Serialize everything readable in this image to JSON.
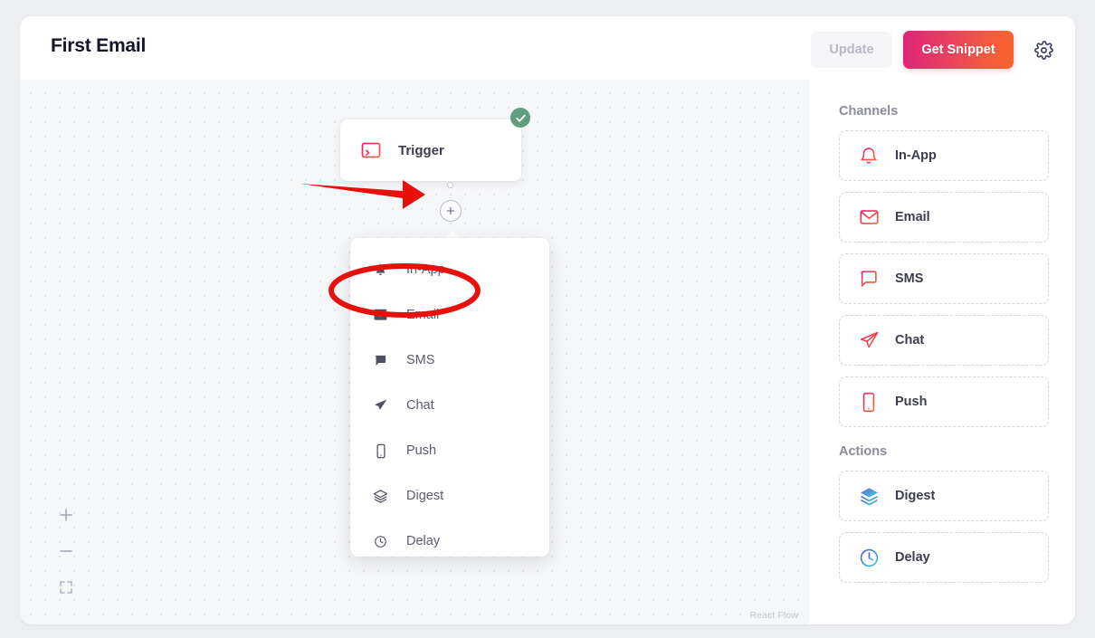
{
  "header": {
    "title": "First Email",
    "update_label": "Update",
    "snippet_label": "Get Snippet",
    "gear_icon": "gear-icon",
    "snippet_gradient_start": "#dd2476",
    "snippet_gradient_end": "#f7642c",
    "update_bg": "#f5f5f8",
    "update_text_color": "#b9b9c6"
  },
  "canvas": {
    "trigger_node": {
      "label": "Trigger",
      "icon": "terminal-icon",
      "status_icon": "check-circle-icon",
      "status_color": "#5f9e81"
    },
    "add_node_button": {
      "icon": "plus-icon"
    },
    "attribution": "React Flow",
    "controls": [
      {
        "name": "zoom-in",
        "icon": "plus-icon"
      },
      {
        "name": "zoom-out",
        "icon": "minus-icon"
      },
      {
        "name": "fit-view",
        "icon": "fit-view-icon"
      }
    ],
    "dropdown": {
      "items": [
        {
          "label": "In-App",
          "icon": "bell-icon"
        },
        {
          "label": "Email",
          "icon": "envelope-icon"
        },
        {
          "label": "SMS",
          "icon": "chat-bubble-icon"
        },
        {
          "label": "Chat",
          "icon": "paper-plane-icon"
        },
        {
          "label": "Push",
          "icon": "mobile-icon"
        },
        {
          "label": "Digest",
          "icon": "layers-icon"
        },
        {
          "label": "Delay",
          "icon": "clock-icon"
        }
      ]
    }
  },
  "sidebar": {
    "channels_heading": "Channels",
    "actions_heading": "Actions",
    "channels": [
      {
        "label": "In-App",
        "icon": "bell-icon"
      },
      {
        "label": "Email",
        "icon": "envelope-icon"
      },
      {
        "label": "SMS",
        "icon": "chat-bubble-icon"
      },
      {
        "label": "Chat",
        "icon": "paper-plane-icon"
      },
      {
        "label": "Push",
        "icon": "mobile-icon"
      }
    ],
    "actions": [
      {
        "label": "Digest",
        "icon": "layers-icon"
      },
      {
        "label": "Delay",
        "icon": "clock-icon"
      }
    ],
    "channel_icon_gradient": [
      "#e3256b",
      "#f7643a"
    ],
    "action_icon_gradient": [
      "#4f5dc4",
      "#35c8e8"
    ]
  },
  "annotations": {
    "arrow": {
      "shape": "arrow",
      "color": "#e8100a",
      "points_to": "add-node-button"
    },
    "ellipse": {
      "shape": "ellipse",
      "color": "#e8100a",
      "encircles": "dropdown-item-email"
    }
  }
}
